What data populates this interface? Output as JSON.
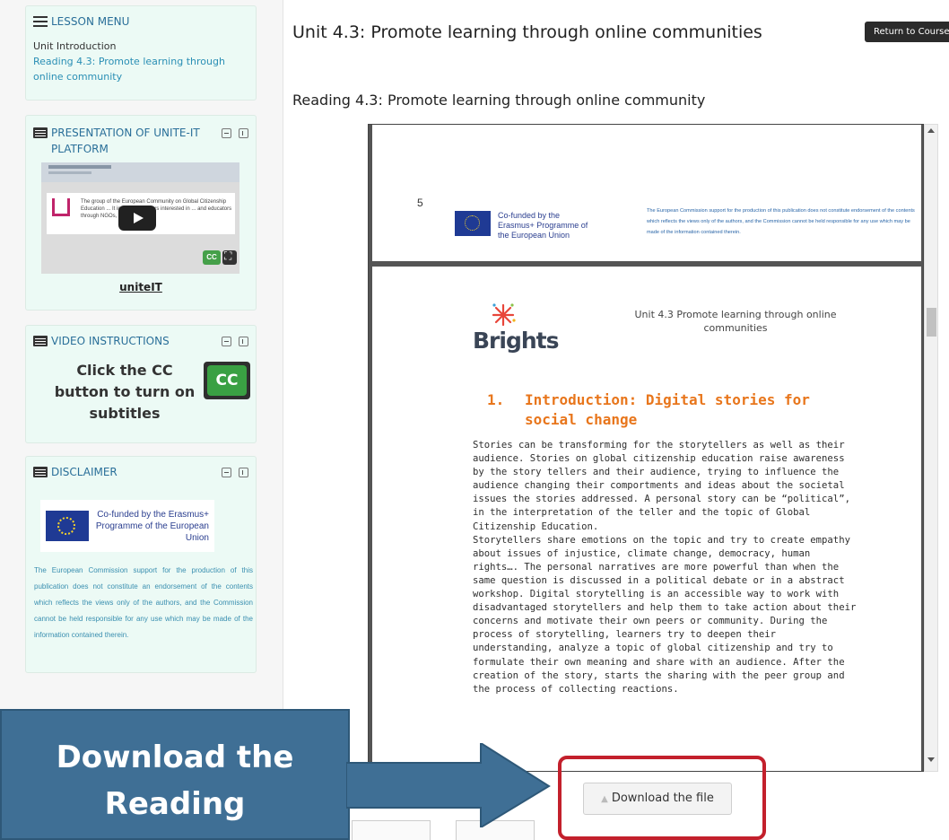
{
  "sidebar": {
    "lesson_menu": {
      "title": "LESSON MENU",
      "items": [
        "Unit Introduction",
        "Reading 4.3: Promote learning through online community"
      ]
    },
    "presentation": {
      "title": "PRESENTATION OF UNITE-IT PLATFORM",
      "video_text": "The group of the European Community on Global Citizenship Education ... It involves all actors interested in ... and educators through NGOs, to ... others.",
      "link": "uniteIT"
    },
    "video_instructions": {
      "title": "VIDEO INSTRUCTIONS",
      "text": "Click the CC button to turn on subtitles",
      "badge": "CC"
    },
    "disclaimer": {
      "title": "DISCLAIMER",
      "eu_text": "Co-funded by the Erasmus+ Programme of the European Union",
      "text": "The European Commission support for the production of this publication does not constitute an endorsement of the contents which reflects the views only of the authors, and the Commission cannot be held responsible for any use which may be made of the information contained therein."
    }
  },
  "main": {
    "title": "Unit 4.3: Promote learning through online communities",
    "return_button": "Return to Course",
    "reading_heading": "Reading 4.3: Promote learning through online community",
    "pdf": {
      "prev_page": {
        "page_number": "5",
        "eu_text": "Co-funded by the Erasmus+ Programme of the European Union",
        "legal": "The European Commission support for the production of this publication does not constitute endorsement of the contents which reflects the views only of the authors, and the Commission cannot be held responsible for any use which may be made of the information contained therein."
      },
      "logo_text": "Brights",
      "header": "Unit 4.3 Promote learning through online communities",
      "section_number": "1.",
      "section_title": "Introduction: Digital stories for social change",
      "body": "Stories can be transforming for the storytellers as well as their audience. Stories on global citizenship education raise awareness by the story tellers and their audience, trying to influence the audience changing their comportments and ideas about the societal issues the stories addressed. A personal story can be “political”, in the interpretation of the teller and the topic of Global Citizenship Education.\nStorytellers share emotions on the topic and try to create empathy about issues of injustice, climate change, democracy, human rights…. The personal narratives are more powerful than when the same question is discussed in a political debate or in a abstract workshop. Digital storytelling is an accessible way to work with disadvantaged storytellers and help them to take action about their concerns and motivate their own peers or community. During the process of storytelling, learners try to deepen their understanding, analyze a topic of global citizenship and try to formulate their own meaning and share with an audience. After the creation of the story, starts the sharing with the peer group and the process of collecting reactions."
    },
    "download_button": "Download the file"
  },
  "callout": {
    "text": "Download the Reading"
  },
  "colors": {
    "block_bg": "#ecfaf5",
    "link": "#2a8fb5",
    "heading_orange": "#e8761c",
    "callout_bg": "#3f6f95",
    "highlight_red": "#c3202c"
  },
  "icons": [
    "menu-icon",
    "minimize-icon",
    "dock-icon",
    "play-icon",
    "cc-icon",
    "fullscreen-icon",
    "eu-flag-icon",
    "download-icon",
    "scroll-up-icon",
    "scroll-down-icon",
    "arrow-icon"
  ]
}
